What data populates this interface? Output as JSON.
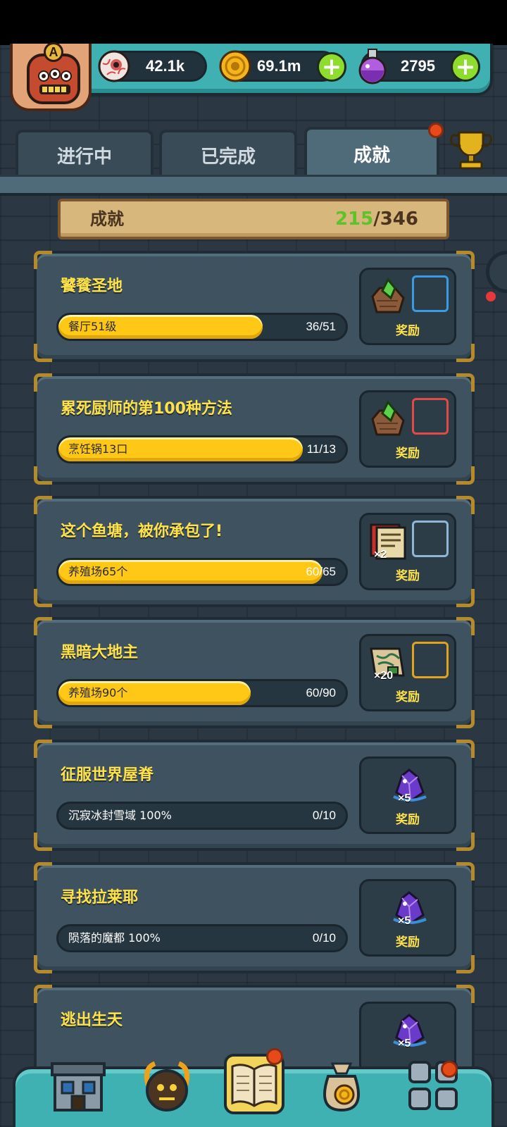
{
  "resources": {
    "eyeball": {
      "value": "42.1k",
      "icon": "eyeball-icon"
    },
    "gold": {
      "value": "69.1m",
      "icon": "gold-coin-icon"
    },
    "potion": {
      "value": "2795",
      "icon": "potion-icon"
    }
  },
  "avatar": {
    "letter": "A"
  },
  "tabs": [
    {
      "label": "进行中"
    },
    {
      "label": "已完成"
    },
    {
      "label": "成就"
    }
  ],
  "banner": {
    "label": "成就",
    "done": "215",
    "total": "/346"
  },
  "achievements": [
    {
      "title": "饕餮圣地",
      "task": "餐厅51级",
      "count": "36/51",
      "progress": 0.706,
      "reward_qty": "",
      "reward_label": "奖励",
      "slot_color": "#3b9be2",
      "reward_icon": "rock-crystal-icon"
    },
    {
      "title": "累死厨师的第100种方法",
      "task": "烹饪锅13口",
      "count": "11/13",
      "progress": 0.846,
      "reward_qty": "",
      "reward_label": "奖励",
      "slot_color": "#e24a4a",
      "reward_icon": "rock-crystal-icon"
    },
    {
      "title": "这个鱼塘，被你承包了!",
      "task": "养殖场65个",
      "count": "60/65",
      "progress": 0.923,
      "reward_qty": "×2",
      "reward_label": "奖励",
      "slot_color": "#8fb6d6",
      "reward_icon": "book-cards-icon"
    },
    {
      "title": "黑暗大地主",
      "task": "养殖场90个",
      "count": "60/90",
      "progress": 0.667,
      "reward_qty": "×20",
      "reward_label": "奖励",
      "slot_color": "#e3a21d",
      "reward_icon": "map-scroll-icon"
    },
    {
      "title": "征服世界屋脊",
      "task": "沉寂冰封雪域 100%",
      "count": "0/10",
      "progress": 0,
      "reward_qty": "×5",
      "reward_label": "奖励",
      "slot_color": "",
      "reward_icon": "purple-gem-icon"
    },
    {
      "title": "寻找拉莱耶",
      "task": "陨落的魔都 100%",
      "count": "0/10",
      "progress": 0,
      "reward_qty": "×5",
      "reward_label": "奖励",
      "slot_color": "",
      "reward_icon": "purple-gem-icon"
    },
    {
      "title": "逃出生天",
      "task": "",
      "count": "",
      "progress": 0,
      "reward_qty": "×5",
      "reward_label": "",
      "slot_color": "",
      "reward_icon": "purple-gem-icon"
    }
  ],
  "bottom_nav": [
    {
      "icon": "shop-building-icon"
    },
    {
      "icon": "monster-icon"
    },
    {
      "icon": "open-book-icon"
    },
    {
      "icon": "money-bag-icon"
    },
    {
      "icon": "grid-menu-icon"
    }
  ]
}
